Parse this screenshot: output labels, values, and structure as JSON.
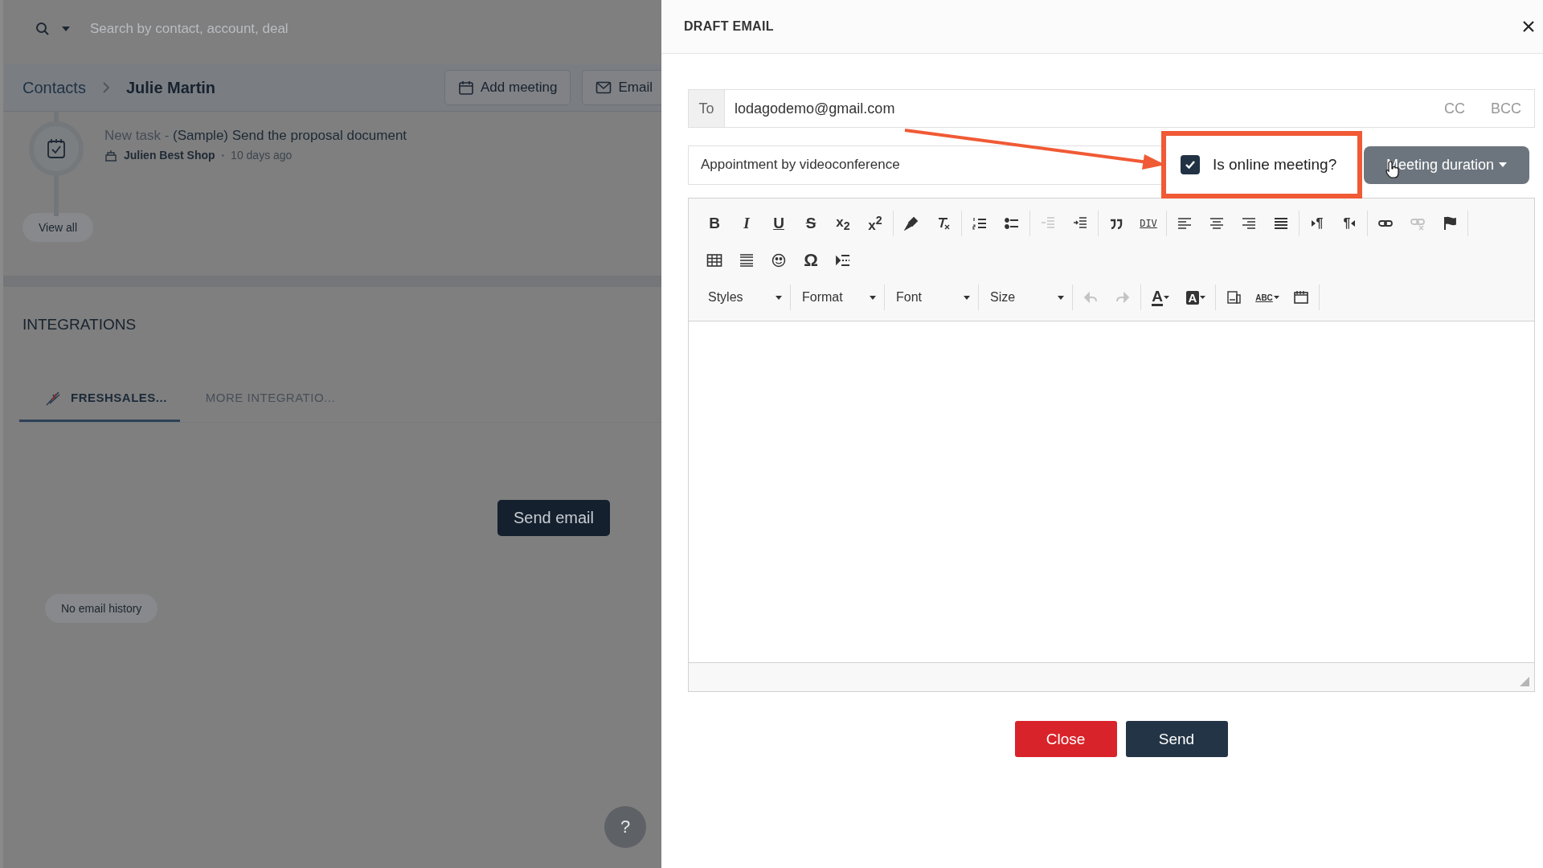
{
  "search": {
    "placeholder": "Search by contact, account, deal"
  },
  "breadcrumb": {
    "parent": "Contacts",
    "current": "Julie Martin"
  },
  "header_actions": [
    {
      "kind": "meeting",
      "label": "Add meeting"
    },
    {
      "kind": "email",
      "label": "Email"
    }
  ],
  "activity": {
    "prefix": "New task - ",
    "title": "(Sample) Send the proposal document",
    "account": "Julien Best Shop",
    "separator": "•",
    "time": "10 days ago"
  },
  "view_all": "View all",
  "integrations": {
    "heading": "INTEGRATIONS",
    "tabs": [
      {
        "kind": "freshsales",
        "label": "FRESHSALES...",
        "selected": true
      },
      {
        "kind": "more",
        "label": "MORE INTEGRATIO...",
        "selected": false
      }
    ],
    "send_button": "Send email",
    "history_badge": "No email history"
  },
  "help_button": "?",
  "drawer": {
    "title": "DRAFT EMAIL",
    "to_label": "To",
    "to_value": "lodagodemo@gmail.com",
    "cc": "CC",
    "bcc": "BCC",
    "subject": "Appointment by videoconference",
    "online_meeting": {
      "label": "Is online meeting?",
      "checked": true
    },
    "duration_button": "Meeting duration",
    "toolbar_rows": [
      [
        [
          {
            "kind": "bold",
            "label": "B",
            "disabled": false
          },
          {
            "kind": "italic",
            "label": "I",
            "disabled": false
          },
          {
            "kind": "underline",
            "label": "U",
            "disabled": false
          },
          {
            "kind": "strike",
            "label": "S",
            "disabled": false
          },
          {
            "kind": "subscript",
            "label": "x$_{2}$",
            "disabled": false
          },
          {
            "kind": "superscript",
            "label": "x$^{2}$",
            "disabled": false
          }
        ],
        [
          {
            "kind": "format-painter",
            "disabled": false
          },
          {
            "kind": "clear-format",
            "disabled": false
          }
        ],
        [
          {
            "kind": "numbered-list",
            "disabled": false
          },
          {
            "kind": "bullet-list",
            "disabled": false
          }
        ],
        [
          {
            "kind": "outdent",
            "disabled": true
          },
          {
            "kind": "indent",
            "disabled": false
          }
        ],
        [
          {
            "kind": "blockquote",
            "disabled": false
          },
          {
            "kind": "div-container",
            "label": "DIV",
            "disabled": false
          }
        ],
        [
          {
            "kind": "align-left",
            "disabled": false
          },
          {
            "kind": "align-center",
            "disabled": false
          },
          {
            "kind": "align-right",
            "disabled": false
          },
          {
            "kind": "justify",
            "disabled": false
          }
        ],
        [
          {
            "kind": "ltr",
            "label": "¶",
            "disabled": false
          },
          {
            "kind": "rtl",
            "label": "¶",
            "disabled": false
          }
        ],
        [
          {
            "kind": "link",
            "disabled": false
          },
          {
            "kind": "unlink",
            "disabled": true
          },
          {
            "kind": "anchor",
            "disabled": false
          }
        ]
      ],
      [
        [
          {
            "kind": "table",
            "disabled": false
          },
          {
            "kind": "horizontal-line",
            "disabled": false
          },
          {
            "kind": "smiley",
            "disabled": false
          },
          {
            "kind": "special-char",
            "label": "Ω",
            "disabled": false
          },
          {
            "kind": "page-break",
            "disabled": false
          }
        ]
      ],
      [
        [
          {
            "kind": "dropdown",
            "label": "Styles",
            "disabled": false
          }
        ],
        [
          {
            "kind": "dropdown",
            "label": "Format",
            "disabled": false
          }
        ],
        [
          {
            "kind": "dropdown",
            "label": "Font",
            "disabled": false
          }
        ],
        [
          {
            "kind": "dropdown",
            "label": "Size",
            "disabled": false
          }
        ],
        [
          {
            "kind": "undo",
            "disabled": true
          },
          {
            "kind": "redo",
            "disabled": true
          }
        ],
        [
          {
            "kind": "text-color",
            "label": "A",
            "disabled": false
          },
          {
            "kind": "background-color",
            "label": "A",
            "disabled": false
          }
        ],
        [
          {
            "kind": "preview",
            "disabled": false
          },
          {
            "kind": "spellcheck",
            "label": "ABC",
            "disabled": false
          },
          {
            "kind": "maximize",
            "disabled": false
          }
        ]
      ]
    ],
    "buttons": [
      {
        "kind": "close",
        "label": "Close"
      },
      {
        "kind": "send",
        "label": "Send"
      }
    ]
  }
}
